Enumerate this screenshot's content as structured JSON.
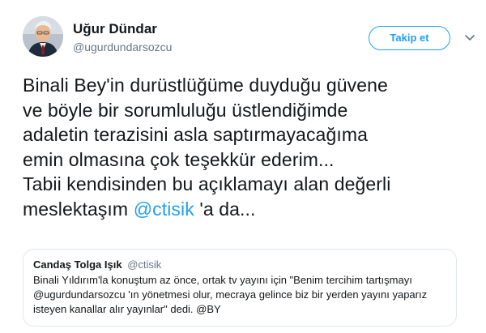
{
  "author": {
    "display_name": "Uğur Dündar",
    "handle": "@ugurdundarsozcu",
    "avatar_icon": "profile-photo"
  },
  "follow_button": {
    "label": "Takip et"
  },
  "menu_icon": "chevron-down-icon",
  "tweet": {
    "line1": "Binali Bey'in durüstlüğüme duyduğu güvene",
    "line2": "ve böyle bir sorumluluğu üstlendiğimde",
    "line3": "adaletin terazisini asla saptırmayacağıma",
    "line4": "emin olmasına çok teşekkür ederim...",
    "line5": "Tabii kendisinden bu açıklamayı alan değerli",
    "line6_prefix": "meslektaşım ",
    "mention": "@ctisik",
    "line6_suffix": " 'a da..."
  },
  "quoted_tweet": {
    "author_name": "Candaş Tolga Işık",
    "author_handle": "@ctisik",
    "line1": "Binali Yıldırım'la konuştum az önce, ortak tv yayını için \"Benim tercihim tartışmayı",
    "line2": "@ugurdundarsozcu 'ın yönetmesi olur, mecraya gelince biz bir yerden yayını yaparız",
    "line3": "isteyen kanallar alır yayınlar\" dedi. @BY"
  },
  "colors": {
    "accent": "#1da1f2",
    "text": "#14171a",
    "secondary": "#657786",
    "border": "#e1e8ed"
  }
}
